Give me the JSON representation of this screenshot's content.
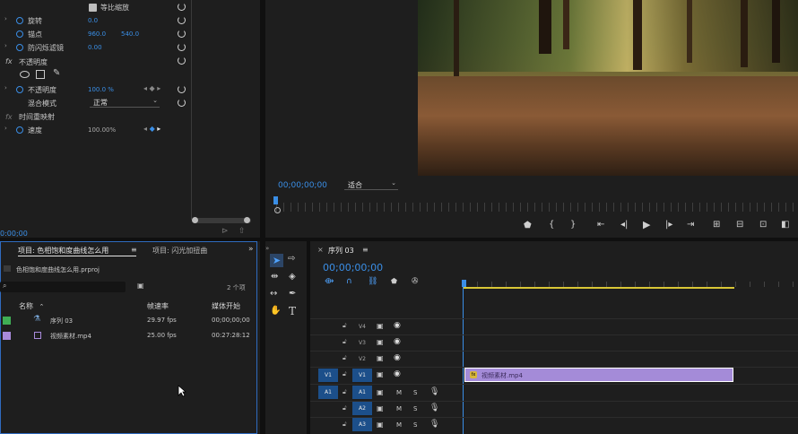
{
  "effect_controls": {
    "uniform_scale": "等比缩放",
    "rotation_label": "旋转",
    "rotation_value": "0.0",
    "anchor_label": "锚点",
    "anchor_x": "960.0",
    "anchor_y": "540.0",
    "flicker_label": "防闪烁滤镜",
    "flicker_value": "0.00",
    "opacity_section": "不透明度",
    "opacity_label": "不透明度",
    "opacity_value": "100.0 %",
    "blend_label": "混合模式",
    "blend_value": "正常",
    "time_remap": "时间重映射",
    "speed_label": "速度",
    "speed_value": "100.00%",
    "timecode": "0:00;00"
  },
  "program_monitor": {
    "timecode": "00;00;00;00",
    "fit_value": "适合"
  },
  "project_panel": {
    "tab_active": "项目: 色相饱和度曲线怎么用",
    "tab_other": "项目: 闪光加扭曲",
    "project_file": "色相饱和度曲线怎么用.prproj",
    "item_count": "2 个项",
    "columns": [
      "名称",
      "帧速率",
      "媒体开始"
    ],
    "items": [
      {
        "name": "序列 03",
        "fps": "29.97 fps",
        "start": "00;00;00;00",
        "color": "#3fae55"
      },
      {
        "name": "视频素材.mp4",
        "fps": "25.00 fps",
        "start": "00:27:28:12",
        "color": "#a98bdc"
      }
    ]
  },
  "timeline": {
    "tab": "序列 03",
    "timecode": "00;00;00;00",
    "tracks_video": [
      "V4",
      "V3",
      "V2",
      "V1"
    ],
    "tracks_audio": [
      "A1",
      "A2",
      "A3"
    ],
    "clip_label": "视频素材.mp4",
    "mute": "M",
    "solo": "S"
  },
  "tools": {
    "type_tool": "T"
  }
}
